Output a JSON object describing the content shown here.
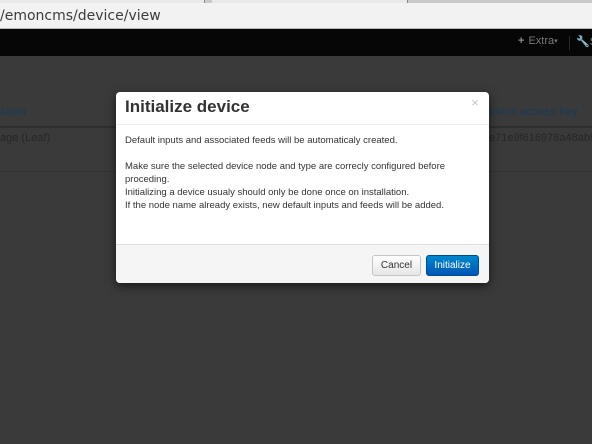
{
  "browser": {
    "url": "/emoncms/device/view"
  },
  "navbar": {
    "extra_label": "Extra",
    "extra_icon": "plus-icon",
    "settings_label": "S",
    "settings_icon": "wrench-icon"
  },
  "table": {
    "headers": [
      "ation",
      "evice access key"
    ],
    "row": {
      "type": "age (Leaf)",
      "key": "e71e9f616978a48ab9578"
    }
  },
  "modal": {
    "title": "Initialize device",
    "close_glyph": "×",
    "lines": [
      "Default inputs and associated feeds will be automaticaly created.",
      "",
      "Make sure the selected device node and type are correcly configured before",
      "proceding.",
      "Initializing a device usualy should only be done once on installation.",
      "If the node name already exists, new default inputs and feeds will be added."
    ],
    "cancel_label": "Cancel",
    "initialize_label": "Initialize"
  },
  "colors": {
    "primary": "#0074cc",
    "navbar": "#060606",
    "overlay": "#3a3a3a"
  }
}
